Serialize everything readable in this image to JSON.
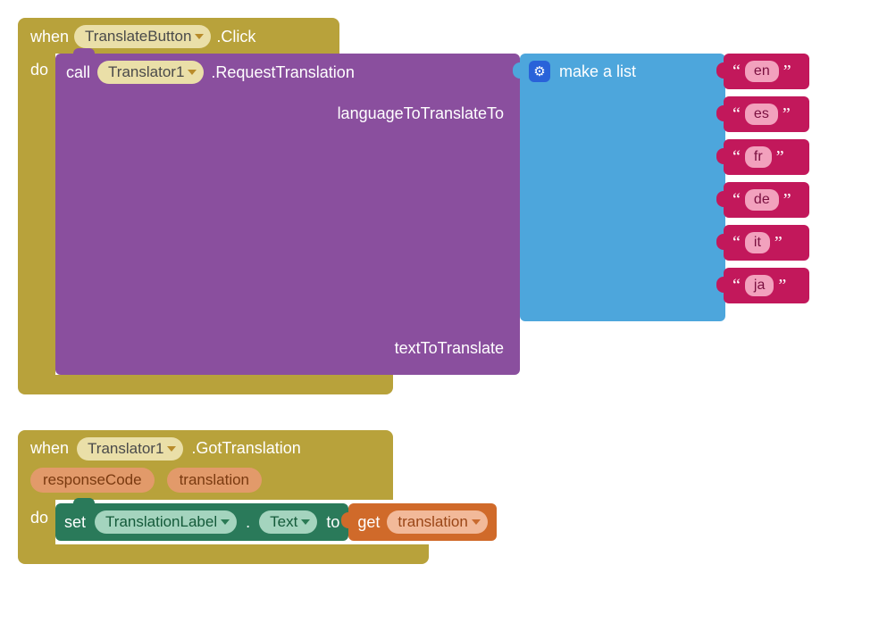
{
  "event1": {
    "when": "when",
    "component": "TranslateButton",
    "event": ".Click",
    "do": "do"
  },
  "call_block": {
    "call": "call",
    "component": "Translator1",
    "method": ".RequestTranslation",
    "arg_lang": "languageToTranslateTo",
    "arg_text": "textToTranslate"
  },
  "list_block": {
    "label": "make a list"
  },
  "list_items": [
    "en",
    "es",
    "fr",
    "de",
    "it",
    "ja"
  ],
  "quote_open": "“",
  "quote_close": "”",
  "gear_glyph": "⚙",
  "event2": {
    "when": "when",
    "component": "Translator1",
    "event": ".GotTranslation",
    "param1": "responseCode",
    "param2": "translation",
    "do": "do"
  },
  "set_block": {
    "set": "set",
    "component": "TranslationLabel",
    "dot": ".",
    "property": "Text",
    "to": "to"
  },
  "get_block": {
    "get": "get",
    "var": "translation"
  }
}
